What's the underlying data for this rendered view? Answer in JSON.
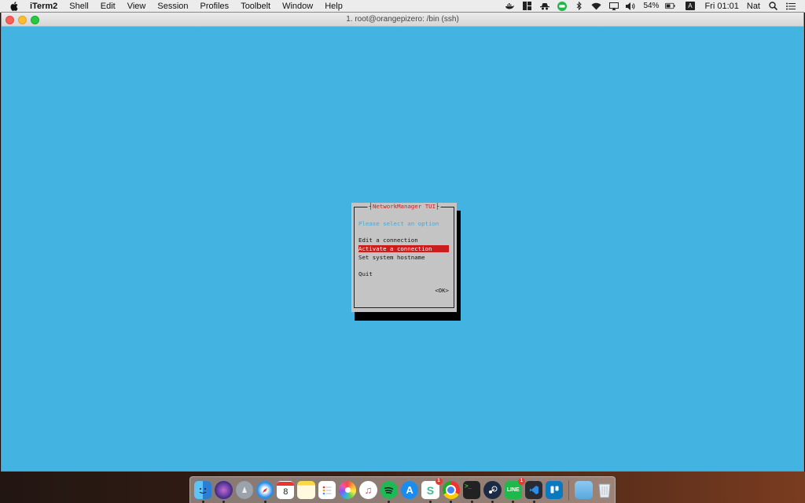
{
  "menubar": {
    "app_name": "iTerm2",
    "items": [
      "Shell",
      "Edit",
      "View",
      "Session",
      "Profiles",
      "Toolbelt",
      "Window",
      "Help"
    ],
    "battery": "54%",
    "input_source": "A",
    "clock": "Fri 01:01",
    "user": "Nat"
  },
  "window": {
    "title": "1. root@orangepizero: /bin (ssh)",
    "background": "#43b4e1"
  },
  "tui": {
    "title": "NetworkManager TUI",
    "prompt": "Please select an option",
    "options": [
      "Edit a connection",
      "Activate a connection",
      "Set system hostname",
      "Quit"
    ],
    "selected_option": "Activate a connection",
    "ok_button": "<OK>"
  },
  "dock": {
    "calendar_day": "8",
    "badges": {
      "slack": "1",
      "line": "1"
    },
    "apps": [
      "finder-icon",
      "siri-icon",
      "launchpad-icon",
      "safari-icon",
      "calendar-icon",
      "notes-icon",
      "reminders-icon",
      "photos-icon",
      "itunes-icon",
      "spotify-icon",
      "app-store-icon",
      "slack-icon",
      "chrome-icon",
      "terminal-icon",
      "steam-icon",
      "line-icon",
      "visual-studio-code-icon",
      "trello-icon",
      "folder-icon",
      "trash-icon"
    ]
  }
}
